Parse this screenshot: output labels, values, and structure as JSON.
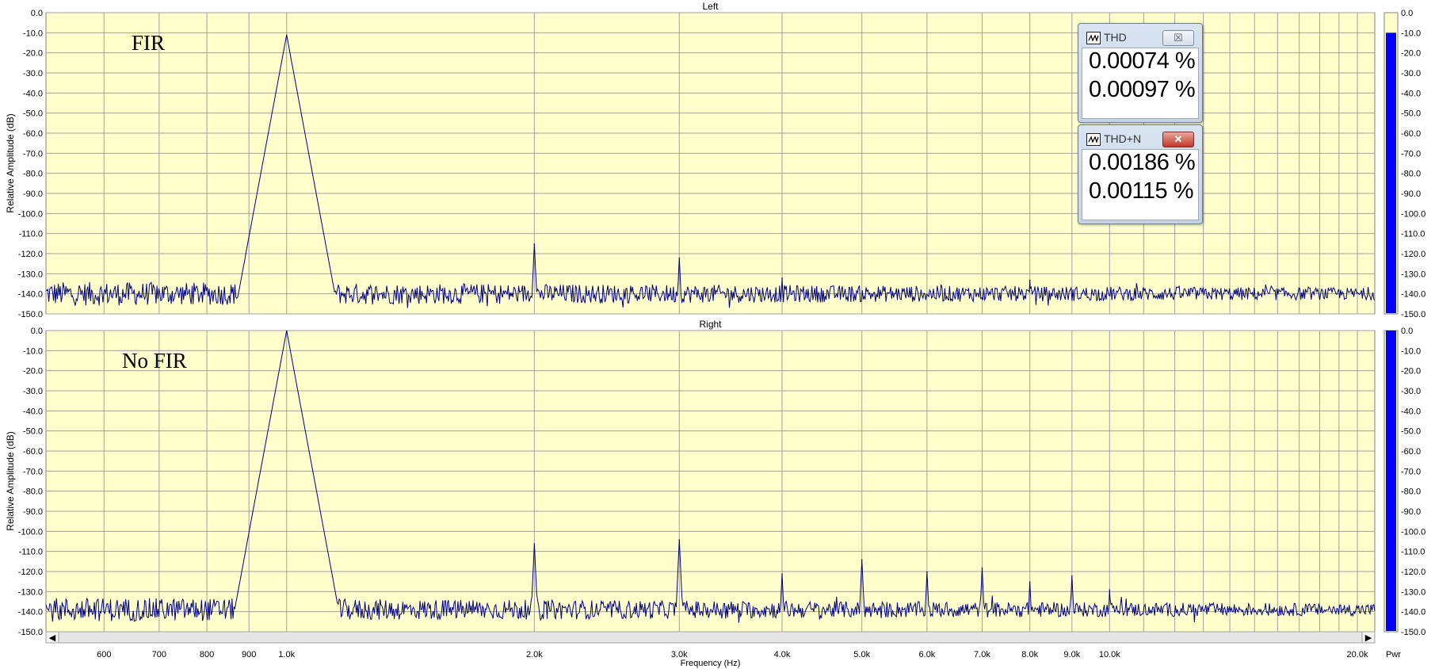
{
  "panels": [
    {
      "title": "Left",
      "label": "FIR"
    },
    {
      "title": "Right",
      "label": "No FIR"
    }
  ],
  "axis": {
    "ylabel": "Relative Amplitude (dB)",
    "xlabel": "Frequency (Hz)",
    "y_ticks": [
      "0.0",
      "-10.0",
      "-20.0",
      "-30.0",
      "-40.0",
      "-50.0",
      "-60.0",
      "-70.0",
      "-80.0",
      "-90.0",
      "-100.0",
      "-110.0",
      "-120.0",
      "-130.0",
      "-140.0",
      "-150.0"
    ],
    "x_ticks": [
      "600",
      "700",
      "800",
      "900",
      "1.0k",
      "2.0k",
      "3.0k",
      "4.0k",
      "5.0k",
      "6.0k",
      "7.0k",
      "8.0k",
      "9.0k",
      "10.0k",
      "20.0k"
    ]
  },
  "meters": {
    "thd": {
      "title": "THD",
      "close_label": "☒",
      "values": [
        "0.00074 %",
        "0.00097 %"
      ]
    },
    "thdn": {
      "title": "THD+N",
      "close_label": "✕",
      "values": [
        "0.00186 %",
        "0.00115 %"
      ]
    }
  },
  "pwr_label": "Pwr",
  "scroll": {
    "left_arrow": "◀",
    "right_arrow": "▶"
  },
  "colors": {
    "plot_bg": "#ffffcc",
    "trace": "#000080",
    "meter_bar": "#0000ff",
    "grid": "#a0a0a0"
  },
  "chart_data": [
    {
      "type": "line",
      "title": "Left",
      "annotation": "FIR",
      "xlabel": "Frequency (Hz)",
      "ylabel": "Relative Amplitude (dB)",
      "x_scale": "log",
      "xlim": [
        510,
        21000
      ],
      "ylim": [
        -150,
        0
      ],
      "grid": true,
      "noise_floor_db": -140,
      "peaks": [
        {
          "x": 1000,
          "y": -11
        },
        {
          "x": 2000,
          "y": -115
        },
        {
          "x": 3000,
          "y": -122
        },
        {
          "x": 4000,
          "y": -132
        },
        {
          "x": 8000,
          "y": -133
        }
      ],
      "meter_level_db": -10
    },
    {
      "type": "line",
      "title": "Right",
      "annotation": "No FIR",
      "xlabel": "Frequency (Hz)",
      "ylabel": "Relative Amplitude (dB)",
      "x_scale": "log",
      "xlim": [
        510,
        21000
      ],
      "ylim": [
        -150,
        0
      ],
      "grid": true,
      "noise_floor_db": -139,
      "peaks": [
        {
          "x": 1000,
          "y": 0
        },
        {
          "x": 2000,
          "y": -106
        },
        {
          "x": 3000,
          "y": -104
        },
        {
          "x": 4000,
          "y": -121
        },
        {
          "x": 5000,
          "y": -114
        },
        {
          "x": 6000,
          "y": -120
        },
        {
          "x": 7000,
          "y": -118
        },
        {
          "x": 8000,
          "y": -125
        },
        {
          "x": 9000,
          "y": -122
        },
        {
          "x": 10000,
          "y": -129
        }
      ],
      "meter_level_db": 0
    }
  ]
}
